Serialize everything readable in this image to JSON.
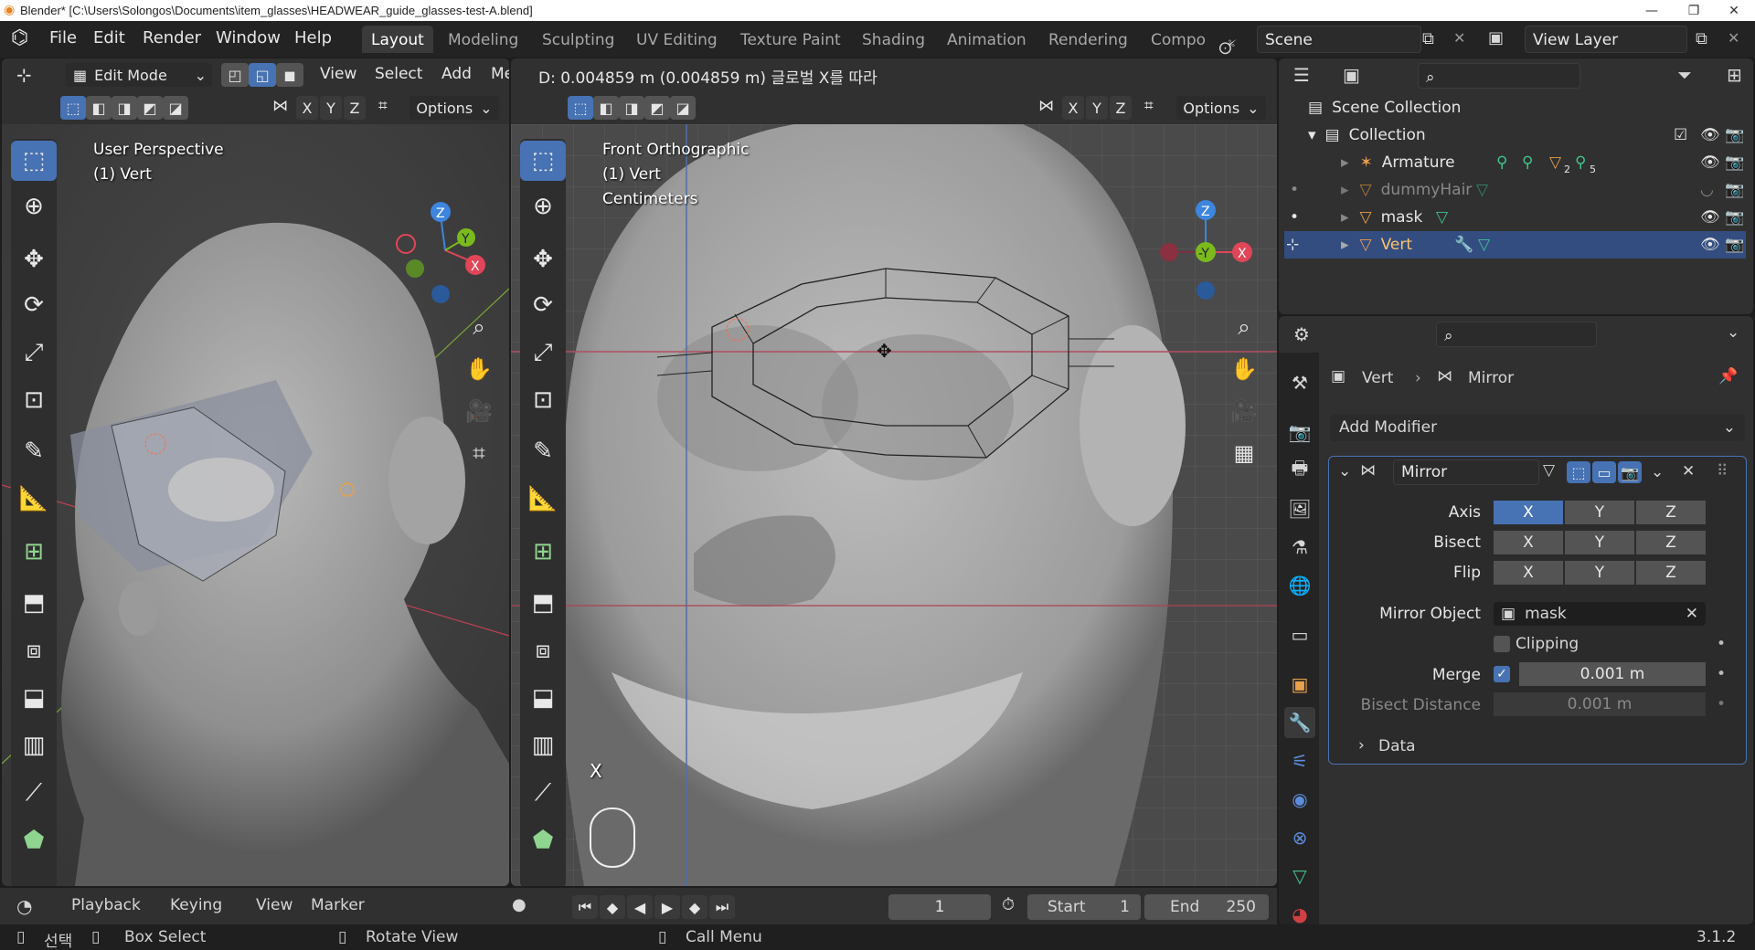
{
  "window": {
    "title": "Blender* [C:\\Users\\Solongos\\Documents\\item_glasses\\HEADWEAR_guide_glasses-test-A.blend]",
    "minimize": "—",
    "maximize": "❐",
    "close": "✕"
  },
  "menu": [
    "File",
    "Edit",
    "Render",
    "Window",
    "Help"
  ],
  "workspaces": [
    "Layout",
    "Modeling",
    "Sculpting",
    "UV Editing",
    "Texture Paint",
    "Shading",
    "Animation",
    "Rendering",
    "Compo"
  ],
  "scene": {
    "name": "Scene",
    "view_layer": "View Layer"
  },
  "left_view": {
    "mode": "Edit Mode",
    "menus": [
      "View",
      "Select",
      "Add",
      "Me"
    ],
    "axes": [
      "X",
      "Y",
      "Z"
    ],
    "options": "Options",
    "perspective": "User Perspective",
    "object": "(1) Vert"
  },
  "right_view": {
    "operator_text": "D: 0.004859 m (0.004859 m) 글로벌 X를 따라",
    "axes": [
      "X",
      "Y",
      "Z"
    ],
    "options": "Options",
    "perspective": "Front Orthographic",
    "object": "(1) Vert",
    "units": "Centimeters",
    "axis_hint": "X"
  },
  "outliner": {
    "scene_collection": "Scene Collection",
    "collection": "Collection",
    "items": [
      {
        "name": "Armature",
        "badge1": "2",
        "badge2": "5"
      },
      {
        "name": "dummyHair"
      },
      {
        "name": "mask"
      },
      {
        "name": "Vert"
      }
    ]
  },
  "properties": {
    "breadcrumb_object": "Vert",
    "breadcrumb_modifier": "Mirror",
    "add_modifier": "Add Modifier",
    "modifier_name": "Mirror",
    "labels": {
      "axis": "Axis",
      "bisect": "Bisect",
      "flip": "Flip",
      "mirror_object": "Mirror Object",
      "clipping": "Clipping",
      "merge": "Merge",
      "bisect_distance": "Bisect Distance",
      "data": "Data"
    },
    "xyz": [
      "X",
      "Y",
      "Z"
    ],
    "mirror_object_value": "mask",
    "merge_value": "0.001 m",
    "bisect_distance_value": "0.001 m",
    "axis_selected": "X",
    "merge_enabled": true,
    "clipping_enabled": false
  },
  "timeline": {
    "menus": [
      "Playback",
      "Keying",
      "View",
      "Marker"
    ],
    "current_frame": "1",
    "start_label": "Start",
    "start_value": "1",
    "end_label": "End",
    "end_value": "250"
  },
  "status": {
    "select": "선택",
    "box_select": "Box Select",
    "rotate_view": "Rotate View",
    "call_menu": "Call Menu",
    "version": "3.1.2"
  },
  "colors": {
    "accent": "#4772b3",
    "outliner_selected": "#334d80",
    "x_axis": "#e04558",
    "y_axis": "#7aba1d",
    "z_axis": "#3d85dd",
    "object_orange": "#e8a04a",
    "mesh_green": "#40c48c"
  }
}
